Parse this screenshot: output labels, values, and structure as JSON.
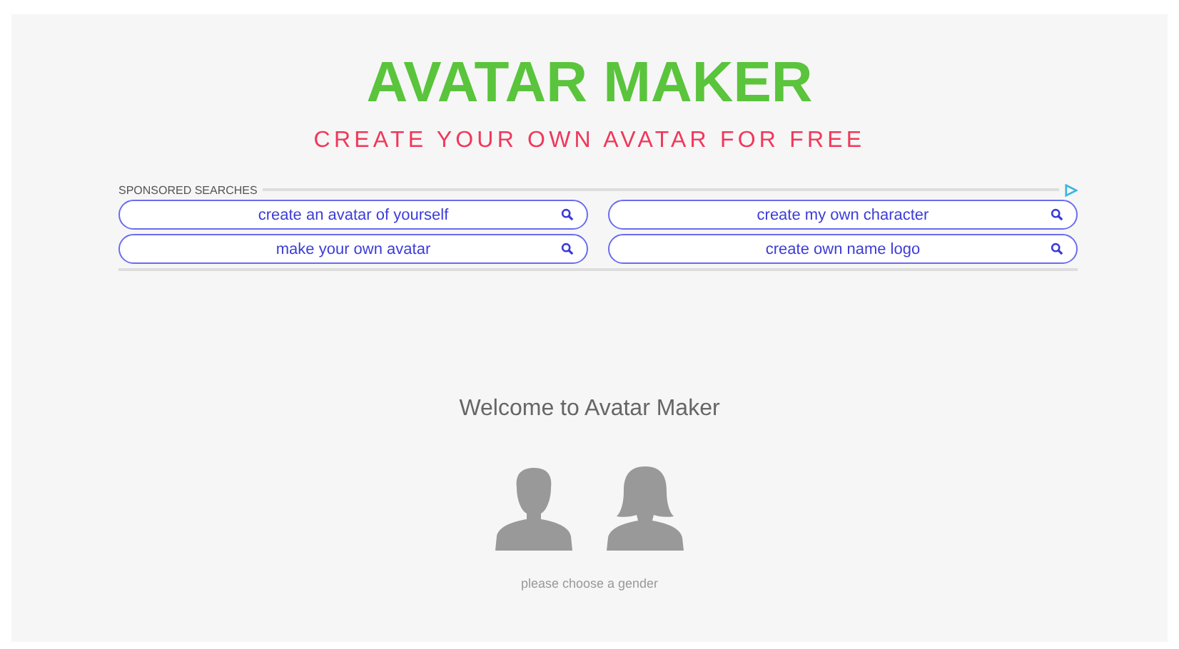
{
  "header": {
    "title": "AVATAR MAKER",
    "subtitle": "CREATE YOUR OWN AVATAR FOR FREE"
  },
  "sponsored": {
    "label": "SPONSORED SEARCHES",
    "searches": [
      {
        "text": "create an avatar of yourself"
      },
      {
        "text": "create my own character"
      },
      {
        "text": "make your own avatar"
      },
      {
        "text": "create own name logo"
      }
    ]
  },
  "welcome": "Welcome to Avatar Maker",
  "genders": [
    {
      "kind": "male"
    },
    {
      "kind": "female"
    }
  ],
  "caption": "please choose a gender"
}
